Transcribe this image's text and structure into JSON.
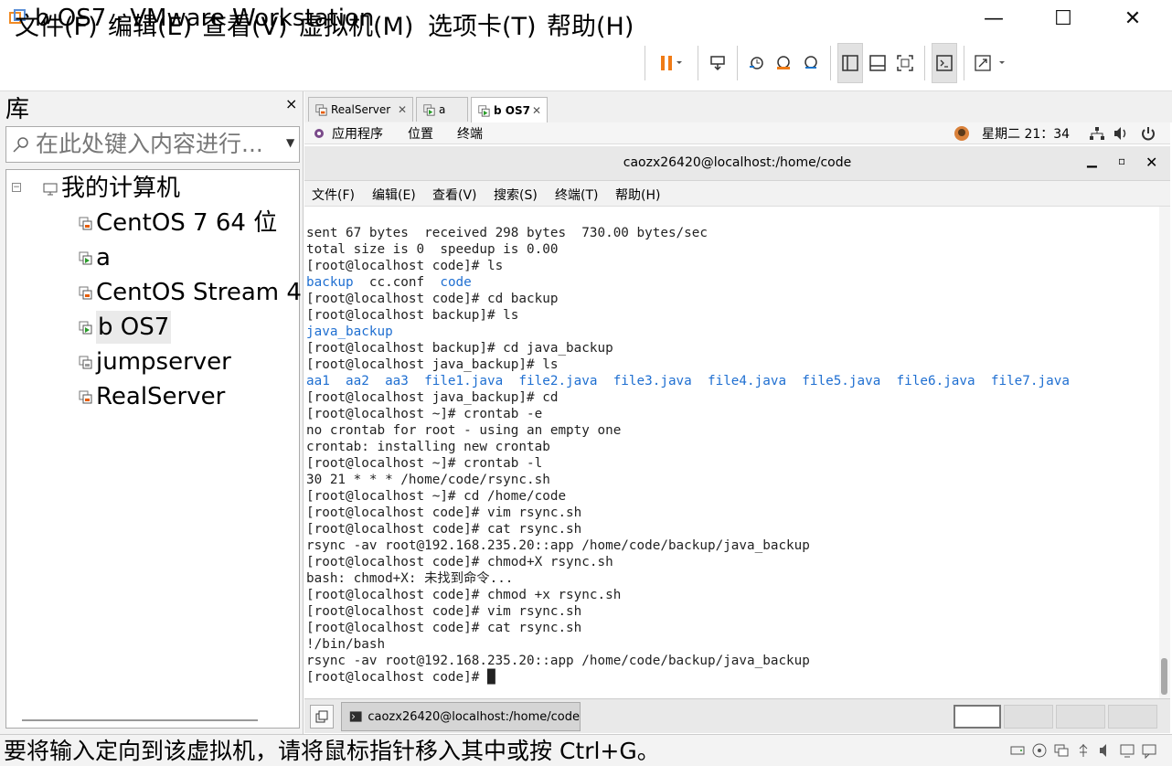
{
  "window": {
    "title": "b OS7 - VMware Workstation",
    "minimize": "—",
    "maximize": "☐",
    "close": "✕"
  },
  "menu": [
    "文件(F)",
    "编辑(E)",
    "查看(V)",
    "虚拟机(M)",
    "选项卡(T)",
    "帮助(H)"
  ],
  "library": {
    "title": "库",
    "close": "×",
    "search_placeholder": "在此处键入内容进行...",
    "root": "我的计算机",
    "vms": [
      "CentOS 7 64 位",
      "a",
      "CentOS Stream 4",
      "b OS7",
      "jumpserver",
      "RealServer"
    ],
    "selected": "b OS7"
  },
  "tabs": [
    {
      "label": "RealServer",
      "active": false
    },
    {
      "label": "a",
      "active": false
    },
    {
      "label": "b OS7",
      "active": true
    }
  ],
  "guest_topbar": {
    "apps": "应用程序",
    "places": "位置",
    "terminal": "终端",
    "clock": "星期二 21：34"
  },
  "terminal": {
    "title": "caozx26420@localhost:/home/code",
    "menu": [
      "文件(F)",
      "编辑(E)",
      "查看(V)",
      "搜索(S)",
      "终端(T)",
      "帮助(H)"
    ],
    "lines": [
      [
        {
          "t": "sent 67 bytes  received 298 bytes  730.00 bytes/sec"
        }
      ],
      [
        {
          "t": "total size is 0  speedup is 0.00"
        }
      ],
      [
        {
          "t": "[root@localhost code]# ls"
        }
      ],
      [
        {
          "t": "backup",
          "c": "blue"
        },
        {
          "t": "  cc.conf  "
        },
        {
          "t": "code",
          "c": "blue"
        }
      ],
      [
        {
          "t": "[root@localhost code]# cd backup"
        }
      ],
      [
        {
          "t": "[root@localhost backup]# ls"
        }
      ],
      [
        {
          "t": "java_backup",
          "c": "blue"
        }
      ],
      [
        {
          "t": "[root@localhost backup]# cd java_backup"
        }
      ],
      [
        {
          "t": "[root@localhost java_backup]# ls"
        }
      ],
      [
        {
          "t": "aa1  aa2  aa3  file1.java  file2.java  file3.java  file4.java  file5.java  file6.java  file7.java",
          "c": "blue"
        }
      ],
      [
        {
          "t": "[root@localhost java_backup]# cd"
        }
      ],
      [
        {
          "t": "[root@localhost ~]# crontab -e"
        }
      ],
      [
        {
          "t": "no crontab for root - using an empty one"
        }
      ],
      [
        {
          "t": "crontab: installing new crontab"
        }
      ],
      [
        {
          "t": "[root@localhost ~]# crontab -l"
        }
      ],
      [
        {
          "t": "30 21 * * * /home/code/rsync.sh"
        }
      ],
      [
        {
          "t": "[root@localhost ~]# cd /home/code"
        }
      ],
      [
        {
          "t": "[root@localhost code]# vim rsync.sh"
        }
      ],
      [
        {
          "t": "[root@localhost code]# cat rsync.sh"
        }
      ],
      [
        {
          "t": "rsync -av root@192.168.235.20::app /home/code/backup/java_backup"
        }
      ],
      [
        {
          "t": "[root@localhost code]# chmod+X rsync.sh"
        }
      ],
      [
        {
          "t": "bash: chmod+X: 未找到命令..."
        }
      ],
      [
        {
          "t": "[root@localhost code]# chmod +x rsync.sh"
        }
      ],
      [
        {
          "t": "[root@localhost code]# vim rsync.sh"
        }
      ],
      [
        {
          "t": "[root@localhost code]# cat rsync.sh"
        }
      ],
      [
        {
          "t": "!/bin/bash"
        }
      ],
      [
        {
          "t": "rsync -av root@192.168.235.20::app /home/code/backup/java_backup"
        }
      ],
      [
        {
          "t": "[root@localhost code]# "
        },
        {
          "t": "█",
          "c": "cursor"
        }
      ]
    ]
  },
  "taskbar": {
    "window_label": "caozx26420@localhost:/home/code"
  },
  "status": {
    "text": "要将输入定向到该虚拟机，请将鼠标指针移入其中或按 Ctrl+G。"
  },
  "colors": {
    "link_blue": "#1f6fd1",
    "pause_orange": "#f07b16"
  },
  "icons": [
    "vmware-app-icon",
    "pause-icon",
    "send-keys-icon",
    "snapshot-icon",
    "revert-snapshot-icon",
    "manage-snapshots-icon",
    "library-view-icon",
    "thumbnail-view-icon",
    "fullscreen-icon",
    "console-icon",
    "stretch-icon",
    "search-icon",
    "computer-icon",
    "vm-icon",
    "network-icon",
    "volume-icon",
    "power-icon"
  ]
}
